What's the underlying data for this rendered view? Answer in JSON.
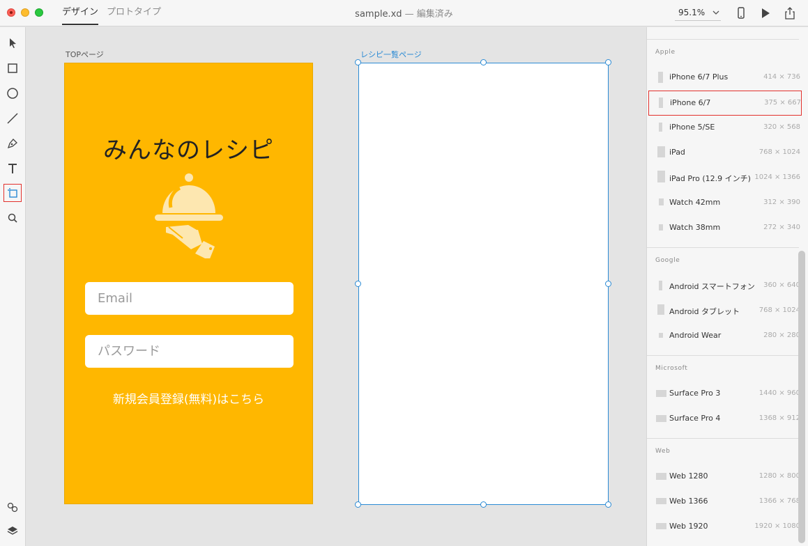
{
  "window": {
    "title": "sample.xd",
    "separator": "—",
    "state": "編集済み"
  },
  "tabs": [
    {
      "label": "デザイン",
      "active": true
    },
    {
      "label": "プロトタイプ",
      "active": false
    }
  ],
  "zoom": {
    "value": "95.1%"
  },
  "icons": {
    "toolbar": [
      "select-arrow-icon",
      "rectangle-icon",
      "ellipse-icon",
      "line-icon",
      "pen-icon",
      "text-icon",
      "artboard-icon",
      "zoom-icon"
    ],
    "bottom": [
      "assets-icon",
      "layers-icon"
    ],
    "top_right": [
      "device-preview-icon",
      "play-icon",
      "share-icon"
    ]
  },
  "artboards": [
    {
      "label": "TOPページ",
      "title": "みんなのレシピ",
      "email_placeholder": "Email",
      "password_placeholder": "パスワード",
      "signup_link": "新規会員登録(無料)はこちら",
      "background": "#ffb700"
    },
    {
      "label": "レシピ一覧ページ",
      "selected": true
    }
  ],
  "presets": {
    "apple": {
      "title": "Apple",
      "items": [
        {
          "name": "iPhone 6/7 Plus",
          "size": "414 × 736"
        },
        {
          "name": "iPhone 6/7",
          "size": "375 × 667",
          "highlighted": true
        },
        {
          "name": "iPhone 5/SE",
          "size": "320 × 568"
        },
        {
          "name": "iPad",
          "size": "768 × 1024"
        },
        {
          "name": "iPad Pro (12.9 インチ)",
          "size": "1024 × 1366"
        },
        {
          "name": "Watch 42mm",
          "size": "312 × 390"
        },
        {
          "name": "Watch 38mm",
          "size": "272 × 340"
        }
      ]
    },
    "google": {
      "title": "Google",
      "items": [
        {
          "name": "Android スマートフォン",
          "size": "360 × 640"
        },
        {
          "name": "Android タブレット",
          "size": "768 × 1024"
        },
        {
          "name": "Android Wear",
          "size": "280 × 280"
        }
      ]
    },
    "microsoft": {
      "title": "Microsoft",
      "items": [
        {
          "name": "Surface Pro 3",
          "size": "1440 × 960"
        },
        {
          "name": "Surface Pro 4",
          "size": "1368 × 912"
        }
      ]
    },
    "web": {
      "title": "Web",
      "items": [
        {
          "name": "Web 1280",
          "size": "1280 × 800"
        },
        {
          "name": "Web 1366",
          "size": "1366 × 768"
        },
        {
          "name": "Web 1920",
          "size": "1920 × 1080"
        }
      ]
    }
  },
  "colors": {
    "accent": "#2a8ad4",
    "highlight": "#e2302c",
    "artboard_bg": "#ffb700"
  }
}
